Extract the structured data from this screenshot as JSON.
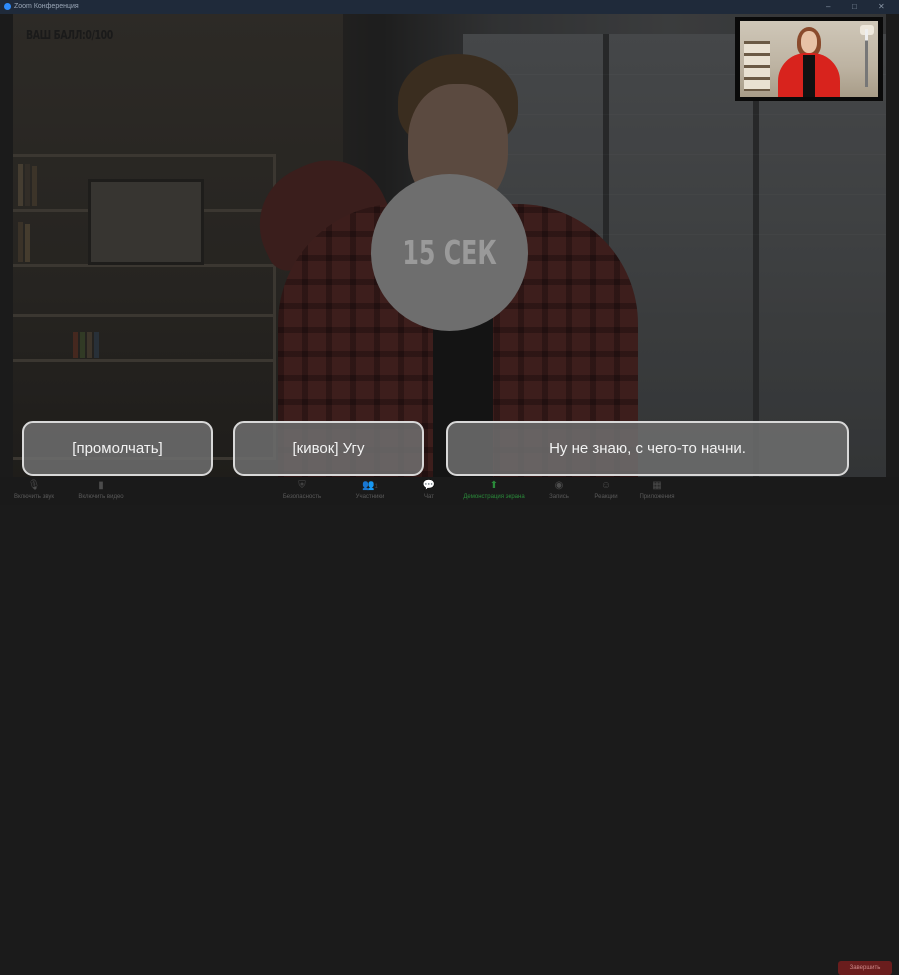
{
  "window": {
    "title": "Zoom Конференция"
  },
  "game": {
    "score_label": "ВАШ БАЛЛ:0/100",
    "timer_label": "15 СЕК",
    "options": [
      {
        "label": "[промолчать]"
      },
      {
        "label": "[кивок] Угу"
      },
      {
        "label": "Ну не знаю, с чего-то начни."
      }
    ]
  },
  "toolbar": {
    "items": [
      {
        "label": "Включить звук",
        "icon": "microphone-muted-icon"
      },
      {
        "label": "Включить видео",
        "icon": "video-off-icon"
      },
      {
        "label": "Безопасность",
        "icon": "shield-icon"
      },
      {
        "label": "Участники",
        "icon": "participants-icon",
        "count": "1"
      },
      {
        "label": "Чат",
        "icon": "chat-icon"
      },
      {
        "label": "Демонстрация экрана",
        "icon": "share-screen-icon"
      },
      {
        "label": "Запись",
        "icon": "record-icon"
      },
      {
        "label": "Реакции",
        "icon": "reactions-icon"
      },
      {
        "label": "Приложения",
        "icon": "apps-icon"
      }
    ],
    "end_label": "Завершить"
  },
  "colors": {
    "share_accent": "#2a8a3a",
    "end_button": "#6a1d1d",
    "pip_border": "#0a0a0a"
  }
}
